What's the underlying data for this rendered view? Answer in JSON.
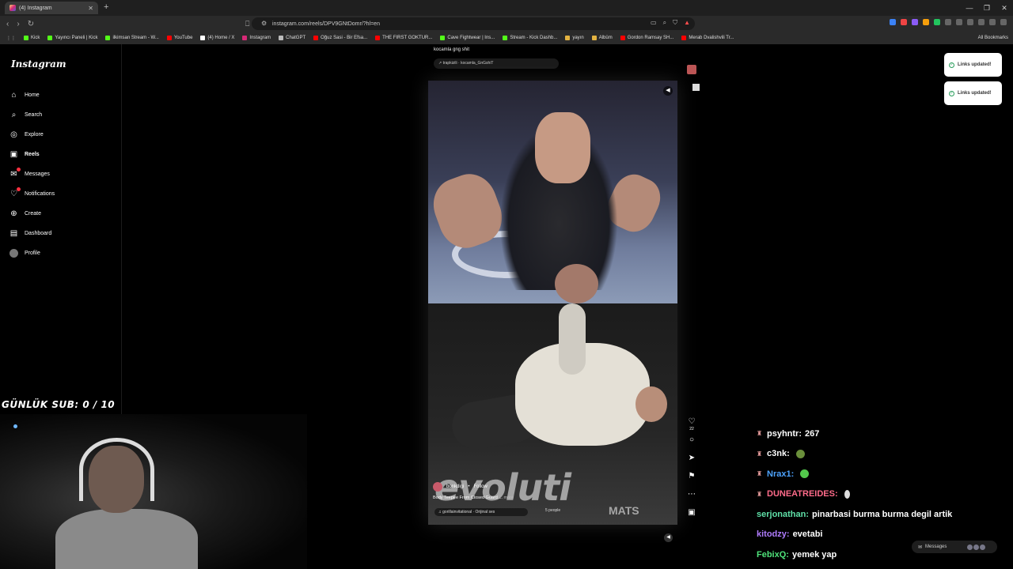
{
  "browser": {
    "tab_title": "(4) Instagram",
    "url": "instagram.com/reels/DPV9GNtDomr/?hl=en",
    "bookmarks": [
      {
        "label": "Kick"
      },
      {
        "label": "Yayıncı Paneli | Kick"
      },
      {
        "label": "ilkimsan Stream - W..."
      },
      {
        "label": "YouTube"
      },
      {
        "label": "(4) Home / X"
      },
      {
        "label": "Instagram"
      },
      {
        "label": "ChatGPT"
      },
      {
        "label": "Oğuz Sasi - Bir Efsa..."
      },
      {
        "label": "THE FIRST GOKTUR..."
      },
      {
        "label": "Cave Fightwear | Ins..."
      },
      {
        "label": "Stream - Kick Dashb..."
      },
      {
        "label": "yayın"
      },
      {
        "label": "Albüm"
      },
      {
        "label": "Gordon Ramsay SH..."
      },
      {
        "label": "Merab Dvalishvili Tr..."
      }
    ],
    "all_bookmarks": "All Bookmarks"
  },
  "sidebar": {
    "logo": "Instagram",
    "items": [
      {
        "label": "Home"
      },
      {
        "label": "Search"
      },
      {
        "label": "Explore"
      },
      {
        "label": "Reels"
      },
      {
        "label": "Messages"
      },
      {
        "label": "Notifications"
      },
      {
        "label": "Create"
      },
      {
        "label": "Dashboard"
      },
      {
        "label": "Profile"
      }
    ]
  },
  "reel": {
    "caption": "kocamla gng shit",
    "audio": "↗ trapkizili · kocamla_GnGshiT",
    "video_logo": "evoluti",
    "video_logo_sub": "MATS",
    "username": "bonkdigi",
    "follow": "Follow",
    "description": "Body Teepee From Closed Guard ...",
    "more": "more",
    "music": "♫ gorillainvitational · Orijinal ses",
    "people": "5 people",
    "likes": "22"
  },
  "toasts": [
    "Links updated!",
    "Links updated!"
  ],
  "stream": {
    "sub_goal": "GÜNLÜK SUB: 0 / 10",
    "chat": [
      {
        "user": "psyhntr:",
        "text": "267",
        "color": "#ffffff"
      },
      {
        "user": "c3nk:",
        "text": "",
        "color": "#ffffff"
      },
      {
        "user": "Nrax1:",
        "text": "",
        "color": "#4da3ff"
      },
      {
        "user": "DUNEATREIDES:",
        "text": "",
        "color": "#ff6b8a"
      },
      {
        "user": "serjonathan:",
        "text": "pinarbasi burma burma degil artik",
        "color": "#5fe0a8"
      },
      {
        "user": "kitodzy:",
        "text": "evetabi",
        "color": "#b07cff"
      },
      {
        "user": "FebixQ:",
        "text": "yemek yap",
        "color": "#4fe37a"
      }
    ],
    "messages_pill": "Messages"
  }
}
